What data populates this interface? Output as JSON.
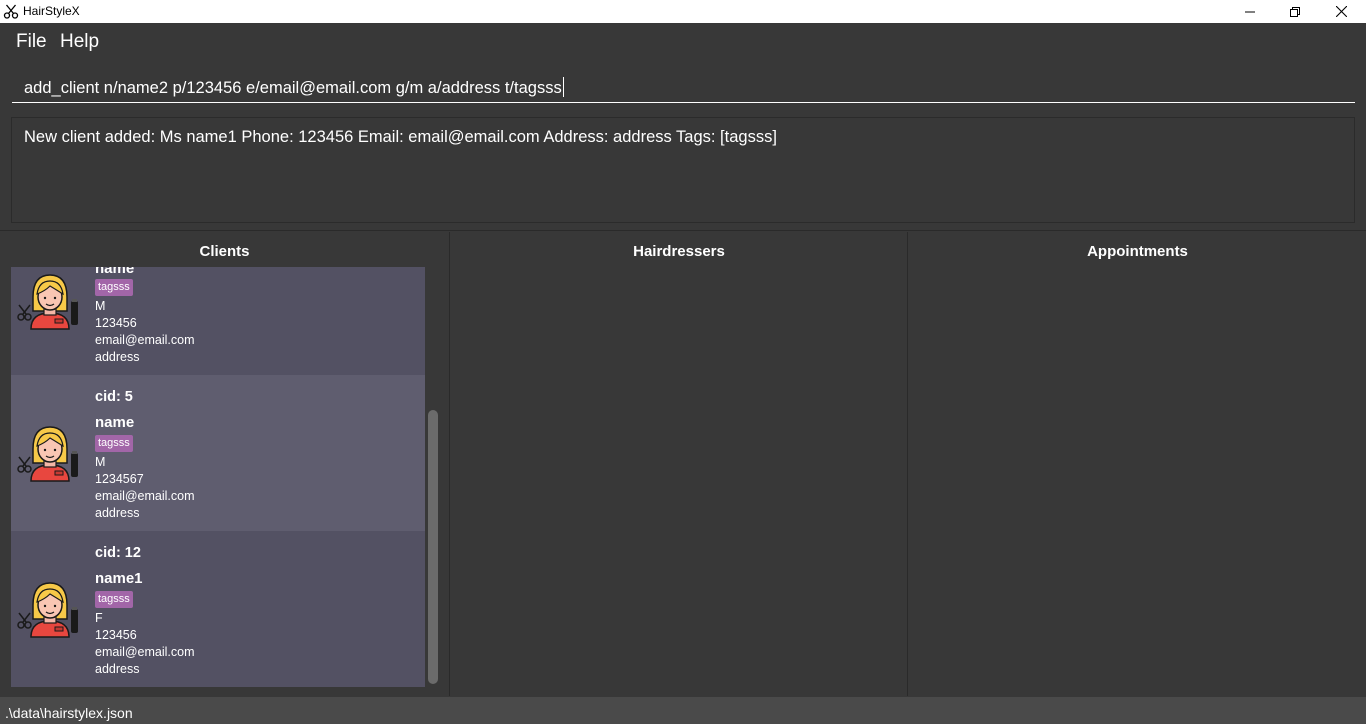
{
  "window": {
    "title": "HairStyleX",
    "icon": "scissors-icon"
  },
  "menu": {
    "file": "File",
    "help": "Help"
  },
  "command": {
    "value": "add_client n/name2 p/123456 e/email@email.com g/m a/address t/tagsss"
  },
  "result": {
    "text": "New client added: Ms name1 Phone: 123456 Email: email@email.com Address: address Tags: [tagsss]"
  },
  "panels": {
    "clients": "Clients",
    "hairdressers": "Hairdressers",
    "appointments": "Appointments"
  },
  "clients": [
    {
      "cid": "",
      "name": "name",
      "tag": "tagsss",
      "gender": "M",
      "phone": "123456",
      "email": "email@email.com",
      "address": "address"
    },
    {
      "cid": "cid: 5",
      "name": "name",
      "tag": "tagsss",
      "gender": "M",
      "phone": "1234567",
      "email": "email@email.com",
      "address": "address"
    },
    {
      "cid": "cid: 12",
      "name": "name1",
      "tag": "tagsss",
      "gender": "F",
      "phone": "123456",
      "email": "email@email.com",
      "address": "address"
    }
  ],
  "status": {
    "path": ".\\data\\hairstylex.json"
  },
  "colors": {
    "background": "#383838",
    "card_even": "#535163",
    "card_odd": "#5f5d6f",
    "tag": "#a266a8"
  }
}
